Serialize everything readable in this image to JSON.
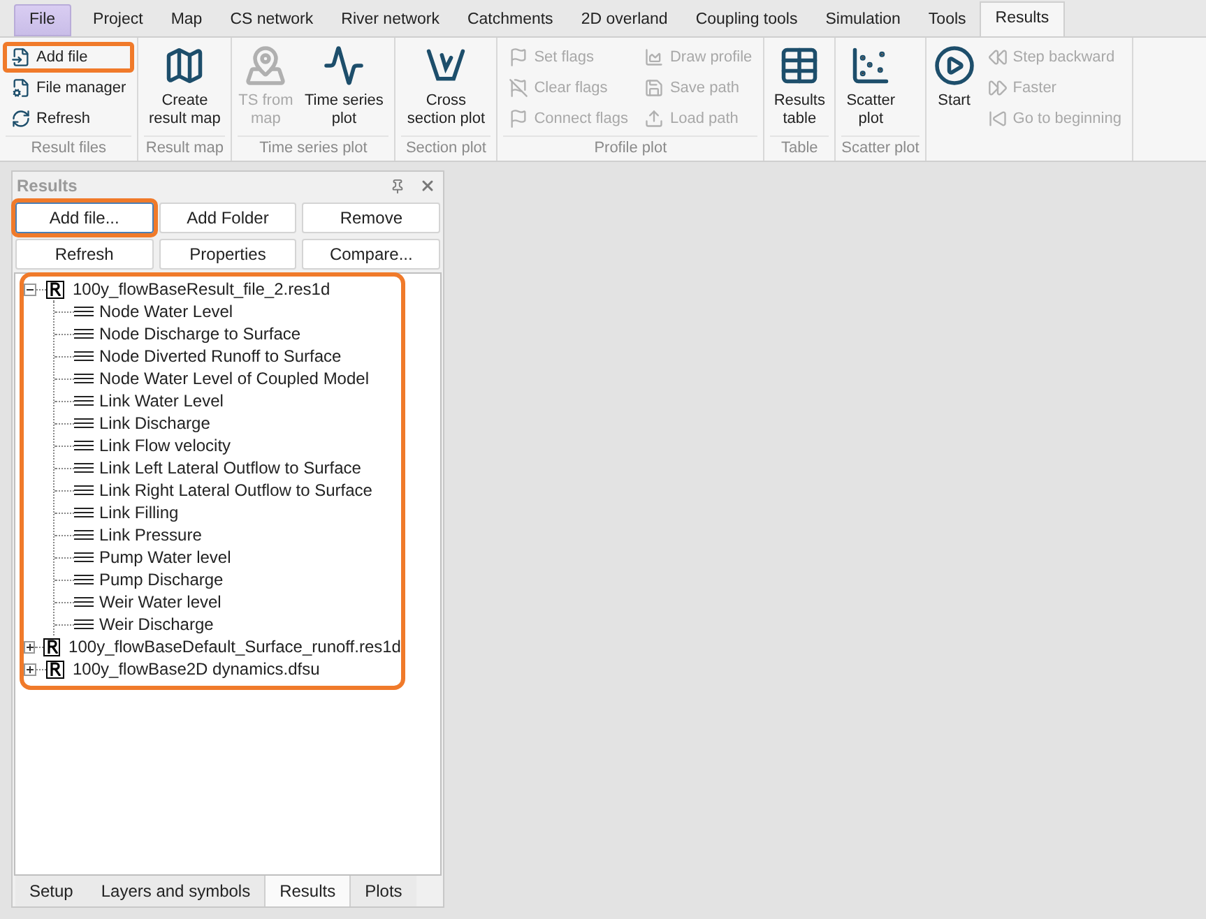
{
  "menu_tabs": [
    {
      "label": "File",
      "selected": false,
      "kind": "file"
    },
    {
      "label": "Project",
      "selected": false
    },
    {
      "label": "Map",
      "selected": false
    },
    {
      "label": "CS network",
      "selected": false
    },
    {
      "label": "River network",
      "selected": false
    },
    {
      "label": "Catchments",
      "selected": false
    },
    {
      "label": "2D overland",
      "selected": false
    },
    {
      "label": "Coupling tools",
      "selected": false
    },
    {
      "label": "Simulation",
      "selected": false
    },
    {
      "label": "Tools",
      "selected": false
    },
    {
      "label": "Results",
      "selected": true
    }
  ],
  "ribbon_groups": [
    {
      "label": "Result files",
      "items": [
        {
          "label": "Add file",
          "kind": "small",
          "disabled": false,
          "highlighted": true
        },
        {
          "label": "File manager",
          "kind": "small",
          "disabled": false,
          "highlighted": false
        },
        {
          "label": "Refresh",
          "kind": "small",
          "disabled": false,
          "highlighted": false
        }
      ]
    },
    {
      "label": "Result map",
      "items": [
        {
          "label": "Create result map",
          "kind": "large",
          "disabled": false
        }
      ]
    },
    {
      "label": "Time series plot",
      "items": [
        {
          "label": "TS from map",
          "kind": "large",
          "disabled": true
        },
        {
          "label": "Time series plot",
          "kind": "large",
          "disabled": false
        }
      ]
    },
    {
      "label": "Section plot",
      "items": [
        {
          "label": "Cross section plot",
          "kind": "large",
          "disabled": false
        }
      ]
    },
    {
      "label": "Profile plot",
      "items": [
        {
          "label": "Set flags",
          "kind": "small",
          "disabled": true,
          "highlighted": false
        },
        {
          "label": "Clear flags",
          "kind": "small",
          "disabled": true,
          "highlighted": false
        },
        {
          "label": "Connect flags",
          "kind": "small",
          "disabled": true,
          "highlighted": false
        },
        {
          "label": "Draw profile",
          "kind": "small",
          "disabled": true,
          "highlighted": false
        },
        {
          "label": "Save path",
          "kind": "small",
          "disabled": true,
          "highlighted": false
        },
        {
          "label": "Load path",
          "kind": "small",
          "disabled": true,
          "highlighted": false
        }
      ]
    },
    {
      "label": "Table",
      "items": [
        {
          "label": "Results table",
          "kind": "large",
          "disabled": false
        }
      ]
    },
    {
      "label": "Scatter plot",
      "items": [
        {
          "label": "Scatter plot",
          "kind": "large",
          "disabled": false
        }
      ]
    },
    {
      "items": [
        {
          "label": "Start",
          "kind": "large",
          "disabled": false
        },
        {
          "label": "Step backward",
          "kind": "small",
          "disabled": true,
          "highlighted": false
        },
        {
          "label": "Faster",
          "kind": "small",
          "disabled": true,
          "highlighted": false
        },
        {
          "label": "Go to beginning",
          "kind": "small",
          "disabled": true,
          "highlighted": false
        }
      ]
    }
  ],
  "panel": {
    "title": "Results",
    "buttons": [
      {
        "label": "Add file...",
        "highlighted": true
      },
      {
        "label": "Add Folder",
        "highlighted": false
      },
      {
        "label": "Remove",
        "highlighted": false
      },
      {
        "label": "Refresh",
        "highlighted": false
      },
      {
        "label": "Properties",
        "highlighted": false
      },
      {
        "label": "Compare...",
        "highlighted": false
      }
    ],
    "tree": {
      "highlighted": true,
      "items": [
        {
          "label": "100y_flowBaseResult_file_2.res1d",
          "expanded": true,
          "children": [
            {
              "label": "Node Water Level"
            },
            {
              "label": "Node Discharge to Surface"
            },
            {
              "label": "Node Diverted Runoff to Surface"
            },
            {
              "label": "Node Water Level of Coupled Model"
            },
            {
              "label": "Link Water Level"
            },
            {
              "label": "Link Discharge"
            },
            {
              "label": "Link Flow velocity"
            },
            {
              "label": "Link Left Lateral Outflow to Surface"
            },
            {
              "label": "Link Right Lateral Outflow to Surface"
            },
            {
              "label": "Link Filling"
            },
            {
              "label": "Link Pressure"
            },
            {
              "label": "Pump Water level"
            },
            {
              "label": "Pump Discharge"
            },
            {
              "label": "Weir Water level"
            },
            {
              "label": "Weir Discharge"
            }
          ]
        },
        {
          "label": "100y_flowBaseDefault_Surface_runoff.res1d",
          "expanded": false
        },
        {
          "label": "100y_flowBase2D dynamics.dfsu",
          "expanded": false
        }
      ]
    },
    "bottom_tabs": [
      {
        "label": "Setup",
        "selected": false
      },
      {
        "label": "Layers and symbols",
        "selected": false
      },
      {
        "label": "Results",
        "selected": true
      },
      {
        "label": "Plots",
        "selected": false
      }
    ]
  }
}
